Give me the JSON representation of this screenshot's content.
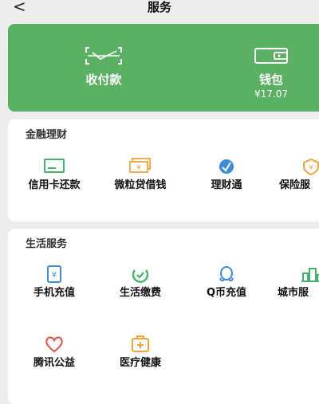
{
  "header": {
    "back_label": "<",
    "title": "服务"
  },
  "wallet_card": {
    "pay": {
      "label": "收付款",
      "icon": "qr-scan-icon"
    },
    "wallet": {
      "label": "钱包",
      "balance": "¥17.07",
      "icon": "wallet-icon"
    }
  },
  "finance": {
    "title": "金融理财",
    "items": [
      {
        "label": "信用卡还款",
        "icon": "credit-card-icon"
      },
      {
        "label": "微粒贷借钱",
        "icon": "loan-cash-icon"
      },
      {
        "label": "理财通",
        "icon": "wealth-icon"
      },
      {
        "label": "保险服",
        "icon": "insurance-icon"
      }
    ]
  },
  "life": {
    "title": "生活服务",
    "items": [
      {
        "label": "手机充值",
        "icon": "phone-topup-icon"
      },
      {
        "label": "生活缴费",
        "icon": "utility-bill-icon"
      },
      {
        "label": "Q币充值",
        "icon": "qq-coin-icon"
      },
      {
        "label": "城市服",
        "icon": "city-service-icon"
      },
      {
        "label": "腾讯公益",
        "icon": "charity-heart-icon"
      },
      {
        "label": "医疗健康",
        "icon": "medical-icon"
      }
    ]
  },
  "colors": {
    "green": "#5ab163",
    "orange": "#f2a33a",
    "blue": "#3f8bd8",
    "teal_green": "#45b26b",
    "red": "#e25b4a"
  }
}
